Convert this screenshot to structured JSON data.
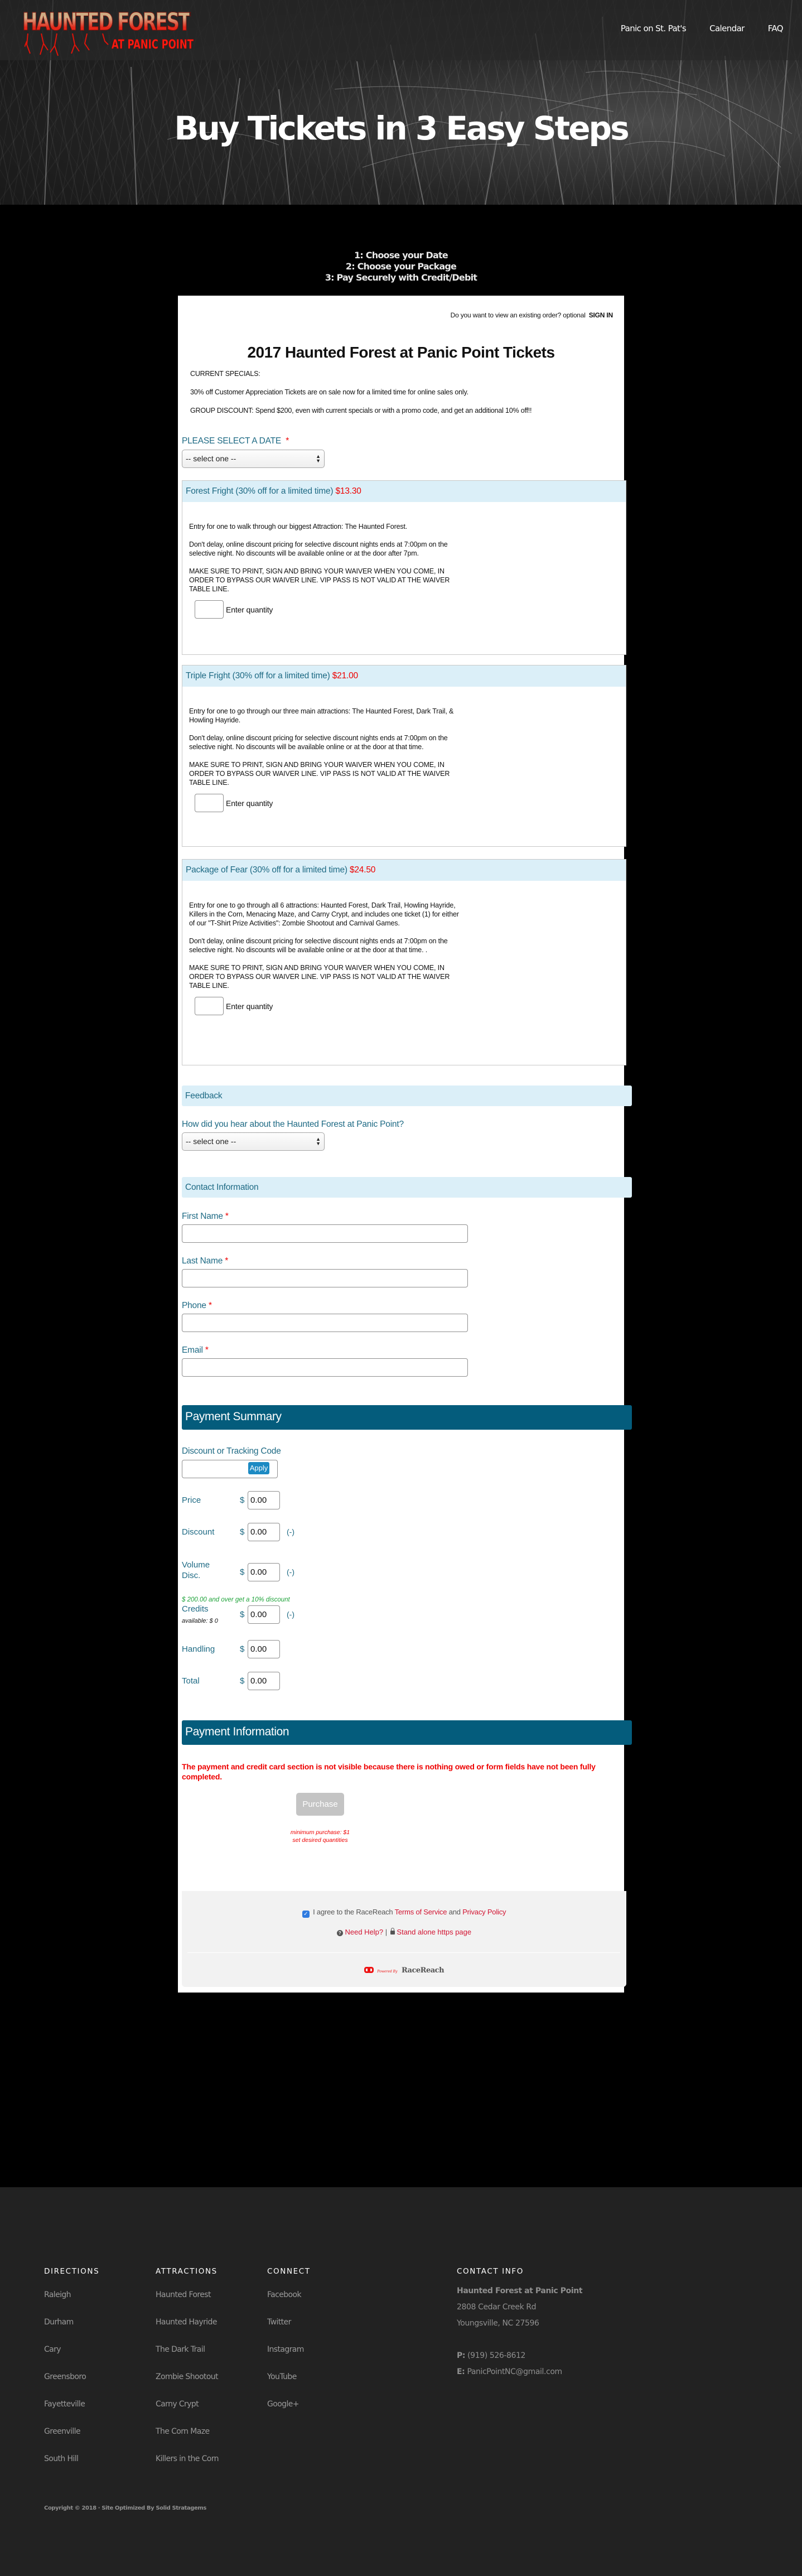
{
  "header": {
    "logo_line1": "HAUNTED FOREST",
    "logo_line2": "AT PANIC POINT",
    "nav": [
      "Panic on St. Pat's",
      "Calendar",
      "FAQ"
    ],
    "hero_title": "Buy Tickets in 3 Easy Steps"
  },
  "steps": [
    "1: Choose your Date",
    "2: Choose your Package",
    "3: Pay Securely with Credit/Debit"
  ],
  "form": {
    "signin_prompt": "Do you want to view an existing order? optional",
    "signin_label": "SIGN IN",
    "title": "2017 Haunted Forest at Panic Point Tickets",
    "specials": [
      "CURRENT SPECIALS:",
      "30% off Customer Appreciation Tickets are on sale now for a limited time for online sales only.",
      "GROUP DISCOUNT: Spend $200, even with current specials or with a promo code, and get an additional 10% off!!"
    ],
    "date_label": "PLEASE SELECT A DATE",
    "required_mark": "*",
    "date_select_value": "-- select one --",
    "packages": [
      {
        "name": "Forest Fright (30% off for a limited time)",
        "price": "$13.30",
        "paragraphs": [
          "Entry for one to walk through our biggest Attraction: The Haunted Forest.",
          "Don't delay, online discount pricing for selective discount nights ends at 7:00pm on the selective night. No discounts will be available online or at the door after 7pm.",
          "MAKE SURE TO PRINT, SIGN AND BRING YOUR WAIVER WHEN YOU COME, IN ORDER TO BYPASS OUR WAIVER LINE. VIP PASS IS NOT VALID AT THE WAIVER TABLE LINE."
        ],
        "quantity_label": "Enter quantity",
        "quantity_value": ""
      },
      {
        "name": "Triple Fright (30% off for a limited time)",
        "price": "$21.00",
        "paragraphs": [
          "Entry for one to go through our three main attractions: The Haunted Forest, Dark Trail, & Howling Hayride.",
          "Don't delay, online discount pricing for selective discount nights ends at 7:00pm on the selective night. No discounts will be available online or at the door at that time.",
          "MAKE SURE TO PRINT, SIGN AND BRING YOUR WAIVER WHEN YOU COME, IN ORDER TO BYPASS OUR WAIVER LINE. VIP PASS IS NOT VALID AT THE WAIVER TABLE LINE."
        ],
        "quantity_label": "Enter quantity",
        "quantity_value": ""
      },
      {
        "name": "Package of Fear (30% off for a limited time)",
        "price": "$24.50",
        "paragraphs": [
          "Entry for one to go through all 6 attractions: Haunted Forest, Dark Trail, Howling Hayride, Killers in the Corn, Menacing Maze, and Carny Crypt, and includes one ticket (1) for either of our \"T-Shirt Prize Activities\": Zombie Shootout and Carnival Games.",
          "Don't delay, online discount pricing for selective discount nights ends at 7:00pm on the selective night. No discounts will be available online or at the door at that time. .",
          "MAKE SURE TO PRINT, SIGN AND BRING YOUR WAIVER WHEN YOU COME, IN ORDER TO BYPASS OUR WAIVER LINE. VIP PASS IS NOT VALID AT THE WAIVER TABLE LINE."
        ],
        "quantity_label": "Enter quantity",
        "quantity_value": ""
      }
    ],
    "feedback": {
      "heading": "Feedback",
      "question": "How did you hear about the Haunted Forest at Panic Point?",
      "select_value": "-- select one --"
    },
    "contact": {
      "heading": "Contact Information",
      "fields": [
        {
          "label": "First Name",
          "value": ""
        },
        {
          "label": "Last Name",
          "value": ""
        },
        {
          "label": "Phone",
          "value": ""
        },
        {
          "label": "Email",
          "value": ""
        }
      ]
    },
    "summary": {
      "heading": "Payment Summary",
      "code_label": "Discount or Tracking Code",
      "code_value": "",
      "apply_label": "Apply",
      "currency": "$",
      "minus": "(-)",
      "price_label": "Price",
      "price": "0.00",
      "discount_label": "Discount",
      "discount": "0.00",
      "volume_label_1": "Volume",
      "volume_label_2": "Disc.",
      "volume": "0.00",
      "volume_note": "$ 200.00 and over get a 10% discount",
      "credits_label": "Credits",
      "credits_available": "available: $ 0",
      "credits": "0.00",
      "handling_label": "Handling",
      "handling": "0.00",
      "total_label": "Total",
      "total": "0.00"
    },
    "payment": {
      "heading": "Payment Information",
      "warning": "The payment and credit card section is not visible because there is nothing owed or form fields have not been fully completed.",
      "purchase_label": "Purchase",
      "min_note_1": "minimum purchase: $1",
      "min_note_2": "set desired quantities"
    },
    "legal": {
      "agree_checked": true,
      "agree_prefix": "I agree to the RaceReach",
      "terms": "Terms of Service",
      "and": "and",
      "privacy": "Privacy Policy",
      "help": "Need Help?",
      "separator": "|",
      "standalone": "Stand alone https page",
      "powered_by": "Powered By",
      "brand": "RaceReach"
    }
  },
  "footer": {
    "columns": [
      {
        "heading": "DIRECTIONS",
        "links": [
          "Raleigh",
          "Durham",
          "Cary",
          "Greensboro",
          "Fayetteville",
          "Greenville",
          "South Hill"
        ]
      },
      {
        "heading": "ATTRACTIONS",
        "links": [
          "Haunted Forest",
          "Haunted Hayride",
          "The Dark Trail",
          "Zombie Shootout",
          "Carny Crypt",
          "The Corn Maze",
          "Killers in the Corn"
        ]
      },
      {
        "heading": "CONNECT",
        "links": [
          "Facebook",
          "Twitter",
          "Instagram",
          "YouTube",
          "Google+"
        ]
      }
    ],
    "contact": {
      "heading": "CONTACT INFO",
      "name": "Haunted Forest at Panic Point",
      "address1": "2808 Cedar Creek Rd",
      "address2": "Youngsville, NC 27596",
      "phone_label": "P:",
      "phone": "(919) 526-8612",
      "email_label": "E:",
      "email": "PanicPointNC@gmail.com"
    },
    "copyright": "Copyright © 2018 · Site Optimized By Solid Stratagems"
  },
  "colors": {
    "teal_text": "#1e6a84",
    "section_header_light": "#dbeff8",
    "section_header_dark": "#045c7c",
    "price_red": "#e00000",
    "apply_blue": "#1c8ac3",
    "volume_green": "#1fa33a",
    "footer_bg": "#222222"
  }
}
